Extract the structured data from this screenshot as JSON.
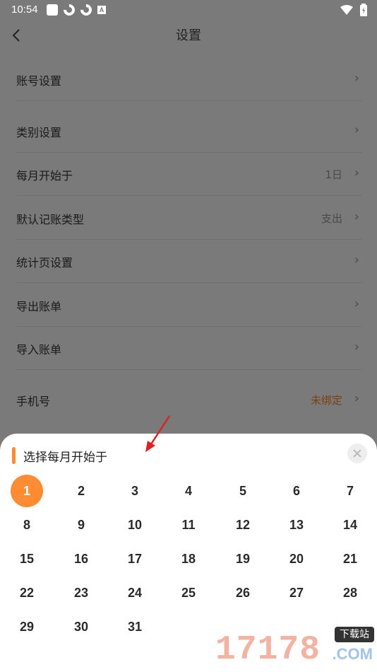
{
  "status_bar": {
    "time": "10:54",
    "notif_badge": "A"
  },
  "header": {
    "title": "设置"
  },
  "settings": [
    {
      "label": "账号设置",
      "value": ""
    },
    {
      "label": "类别设置",
      "value": ""
    },
    {
      "label": "每月开始于",
      "value": "1日"
    },
    {
      "label": "默认记账类型",
      "value": "支出"
    },
    {
      "label": "统计页设置",
      "value": ""
    },
    {
      "label": "导出账单",
      "value": ""
    },
    {
      "label": "导入账单",
      "value": ""
    },
    {
      "label": "手机号",
      "value": "未绑定"
    }
  ],
  "chevron": "›",
  "sheet": {
    "title": "选择每月开始于",
    "selected_day": "1",
    "days": [
      "1",
      "2",
      "3",
      "4",
      "5",
      "6",
      "7",
      "8",
      "9",
      "10",
      "11",
      "12",
      "13",
      "14",
      "15",
      "16",
      "17",
      "18",
      "19",
      "20",
      "21",
      "22",
      "23",
      "24",
      "25",
      "26",
      "27",
      "28",
      "29",
      "30",
      "31"
    ]
  },
  "watermark": {
    "number": "17178",
    "badge": "下载站",
    "domain": ".COM"
  },
  "colors": {
    "accent": "#ff8c33",
    "overlay": "#7a7a7a",
    "arrow": "#e02020"
  }
}
